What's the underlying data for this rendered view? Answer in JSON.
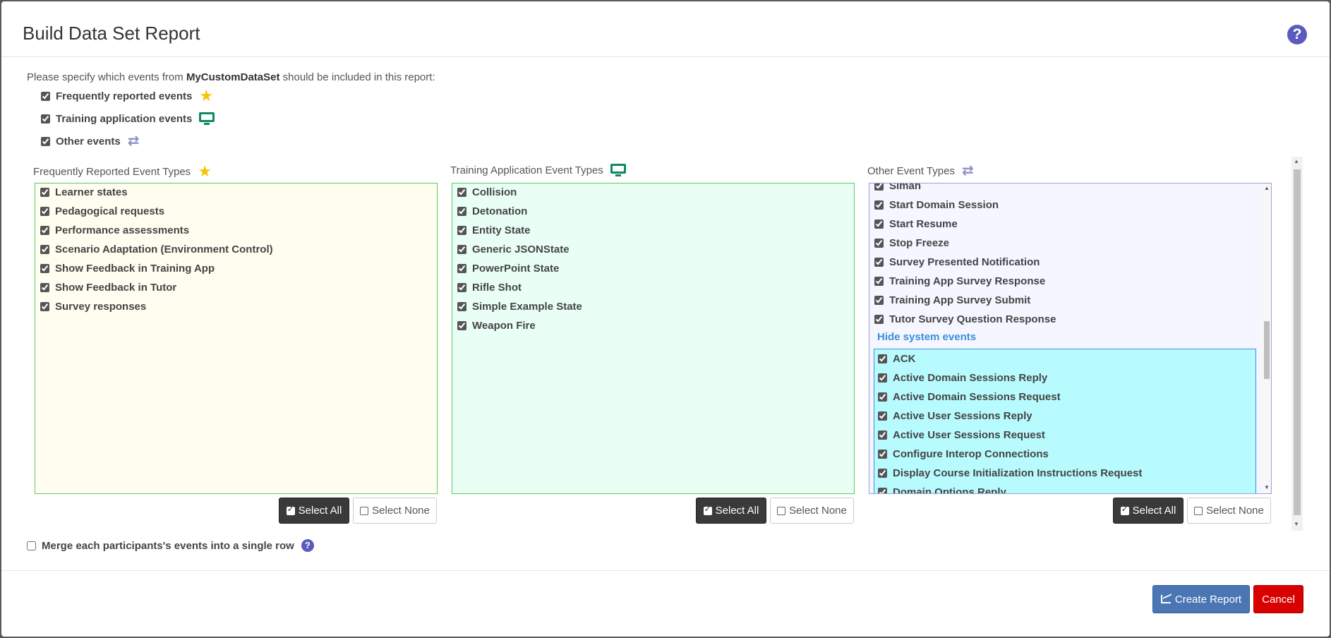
{
  "dialog": {
    "title": "Build Data Set Report",
    "help_icon": "question-circle-icon"
  },
  "intro": {
    "prefix": "Please specify which events from ",
    "dataset": "MyCustomDataSet",
    "suffix": " should be included in this report:"
  },
  "top_options": [
    {
      "label": "Frequently reported events",
      "checked": true,
      "icon": "star-icon"
    },
    {
      "label": "Training application events",
      "checked": true,
      "icon": "monitor-icon"
    },
    {
      "label": "Other events",
      "checked": true,
      "icon": "exchange-arrows-icon"
    }
  ],
  "columns": [
    {
      "label": "Frequently Reported Event Types",
      "icon": "star-icon",
      "items": [
        "Learner states",
        "Pedagogical requests",
        "Performance assessments",
        "Scenario Adaptation (Environment Control)",
        "Show Feedback in Training App",
        "Show Feedback in Tutor",
        "Survey responses"
      ]
    },
    {
      "label": "Training Application Event Types",
      "icon": "monitor-icon",
      "items": [
        "Collision",
        "Detonation",
        "Entity State",
        "Generic JSONState",
        "PowerPoint State",
        "Rifle Shot",
        "Simple Example State",
        "Weapon Fire"
      ]
    },
    {
      "label": "Other Event Types",
      "icon": "exchange-arrows-icon",
      "items": [
        "Siman",
        "Start Domain Session",
        "Start Resume",
        "Stop Freeze",
        "Survey Presented Notification",
        "Training App Survey Response",
        "Training App Survey Submit",
        "Tutor Survey Question Response"
      ],
      "hide_system_link": "Hide system events",
      "system_items": [
        "ACK",
        "Active Domain Sessions Reply",
        "Active Domain Sessions Request",
        "Active User Sessions Reply",
        "Active User Sessions Request",
        "Configure Interop Connections",
        "Display Course Initialization Instructions Request",
        "Domain Options Reply"
      ]
    }
  ],
  "buttons": {
    "select_all": "Select All",
    "select_none": "Select None",
    "create_report": "Create Report",
    "cancel": "Cancel"
  },
  "merge": {
    "label": "Merge each participants's events into a single row",
    "checked": false
  },
  "colors": {
    "primary": "#4a76b4",
    "danger": "#d90000",
    "help": "#5b5bbf",
    "star": "#f5c400",
    "monitor": "#0e8a5e"
  }
}
